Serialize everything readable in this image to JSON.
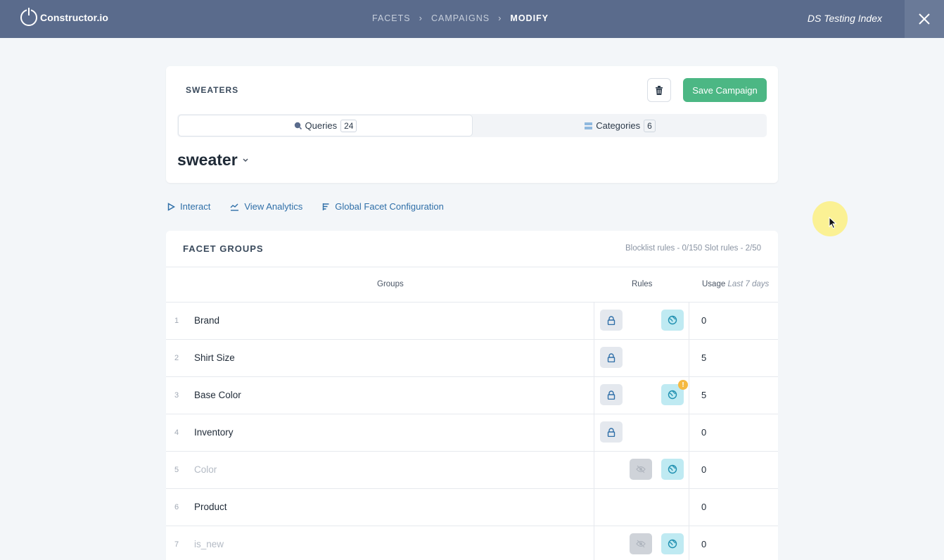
{
  "header": {
    "brand": "Constructor.io",
    "breadcrumbs": [
      "FACETS",
      "CAMPAIGNS",
      "MODIFY"
    ],
    "index_name": "DS Testing Index",
    "colors": {
      "bar": "#5a6b8c"
    }
  },
  "campaign": {
    "title": "SWEATERS",
    "save_label": "Save Campaign",
    "tabs": [
      {
        "label": "Queries",
        "count": "24",
        "icon": "search-icon"
      },
      {
        "label": "Categories",
        "count": "6",
        "icon": "list-icon"
      }
    ],
    "query": "sweater"
  },
  "actions": {
    "interact": "Interact",
    "analytics": "View Analytics",
    "global": "Global Facet Configuration"
  },
  "facet_groups": {
    "title": "FACET GROUPS",
    "limits": "Blocklist rules - 0/150  Slot rules - 2/50",
    "columns": {
      "groups": "Groups",
      "rules": "Rules",
      "usage": "Usage",
      "usage_note": "Last 7 days"
    },
    "rows": [
      {
        "num": "1",
        "name": "Brand",
        "usage": "0"
      },
      {
        "num": "2",
        "name": "Shirt Size",
        "usage": "5"
      },
      {
        "num": "3",
        "name": "Base Color",
        "usage": "5"
      },
      {
        "num": "4",
        "name": "Inventory",
        "usage": "0"
      },
      {
        "num": "5",
        "name": "Color",
        "usage": "0"
      },
      {
        "num": "6",
        "name": "Product",
        "usage": "0"
      },
      {
        "num": "7",
        "name": "is_new",
        "usage": "0"
      }
    ],
    "warning_mark": "!"
  }
}
